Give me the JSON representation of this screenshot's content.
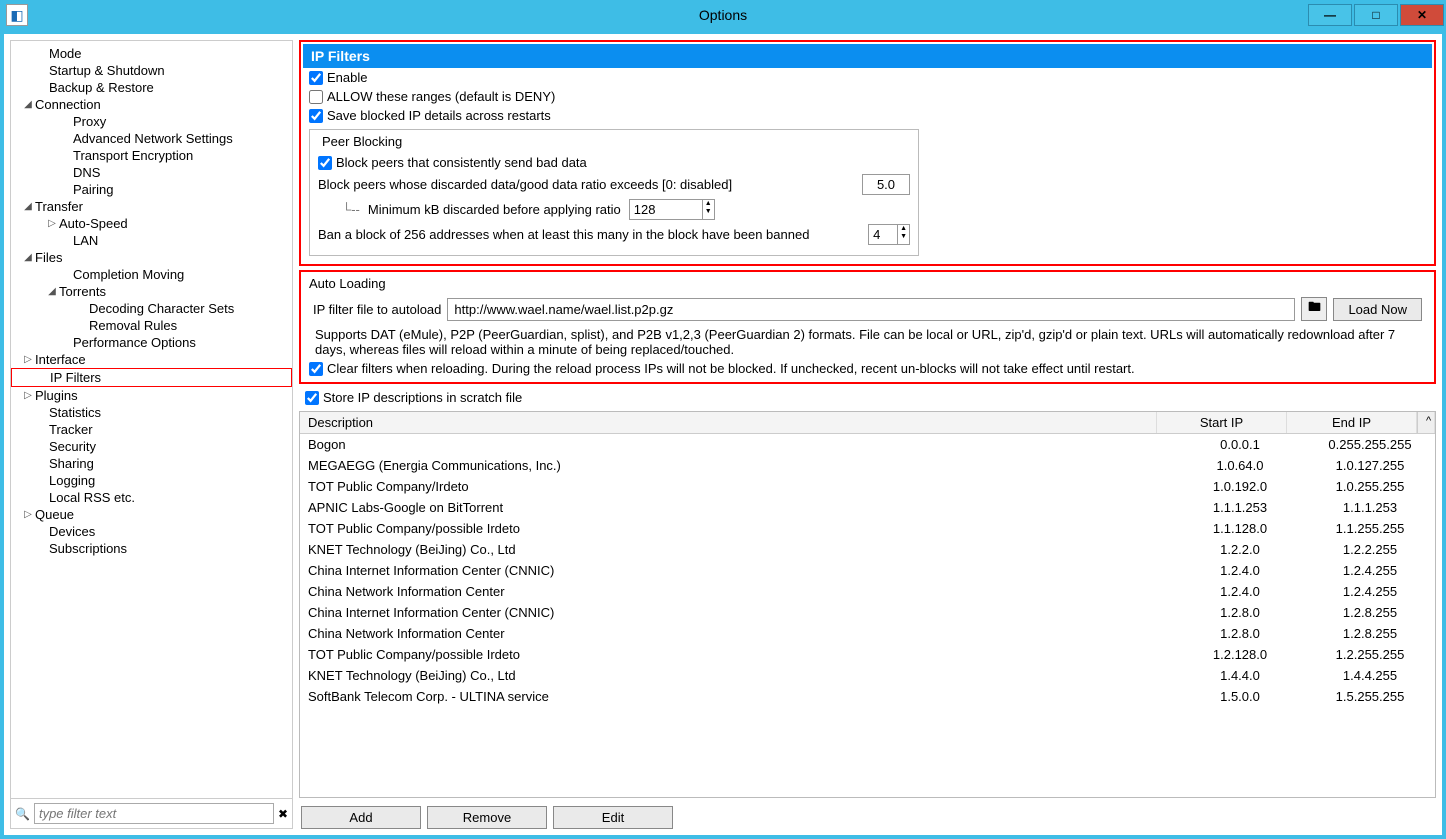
{
  "window": {
    "title": "Options"
  },
  "sidebar": {
    "filter_placeholder": "type filter text",
    "items": [
      {
        "label": "Mode",
        "indent": 24,
        "arrow": ""
      },
      {
        "label": "Startup & Shutdown",
        "indent": 24,
        "arrow": ""
      },
      {
        "label": "Backup & Restore",
        "indent": 24,
        "arrow": ""
      },
      {
        "label": "Connection",
        "indent": 10,
        "arrow": "◢"
      },
      {
        "label": "Proxy",
        "indent": 48,
        "arrow": ""
      },
      {
        "label": "Advanced Network Settings",
        "indent": 48,
        "arrow": ""
      },
      {
        "label": "Transport Encryption",
        "indent": 48,
        "arrow": ""
      },
      {
        "label": "DNS",
        "indent": 48,
        "arrow": ""
      },
      {
        "label": "Pairing",
        "indent": 48,
        "arrow": ""
      },
      {
        "label": "Transfer",
        "indent": 10,
        "arrow": "◢"
      },
      {
        "label": "Auto-Speed",
        "indent": 34,
        "arrow": "▷"
      },
      {
        "label": "LAN",
        "indent": 48,
        "arrow": ""
      },
      {
        "label": "Files",
        "indent": 10,
        "arrow": "◢"
      },
      {
        "label": "Completion Moving",
        "indent": 48,
        "arrow": ""
      },
      {
        "label": "Torrents",
        "indent": 34,
        "arrow": "◢"
      },
      {
        "label": "Decoding Character Sets",
        "indent": 64,
        "arrow": ""
      },
      {
        "label": "Removal Rules",
        "indent": 64,
        "arrow": ""
      },
      {
        "label": "Performance Options",
        "indent": 48,
        "arrow": ""
      },
      {
        "label": "Interface",
        "indent": 10,
        "arrow": "▷"
      },
      {
        "label": "IP Filters",
        "indent": 24,
        "arrow": "",
        "selected": true
      },
      {
        "label": "Plugins",
        "indent": 10,
        "arrow": "▷"
      },
      {
        "label": "Statistics",
        "indent": 24,
        "arrow": ""
      },
      {
        "label": "Tracker",
        "indent": 24,
        "arrow": ""
      },
      {
        "label": "Security",
        "indent": 24,
        "arrow": ""
      },
      {
        "label": "Sharing",
        "indent": 24,
        "arrow": ""
      },
      {
        "label": "Logging",
        "indent": 24,
        "arrow": ""
      },
      {
        "label": "Local RSS etc.",
        "indent": 24,
        "arrow": ""
      },
      {
        "label": "Queue",
        "indent": 10,
        "arrow": "▷"
      },
      {
        "label": "Devices",
        "indent": 24,
        "arrow": ""
      },
      {
        "label": "Subscriptions",
        "indent": 24,
        "arrow": ""
      }
    ]
  },
  "main": {
    "header": "IP Filters",
    "enable_label": "Enable",
    "allow_label": "ALLOW these ranges (default is DENY)",
    "save_blocked_label": "Save blocked IP details across restarts",
    "peer_blocking_title": "Peer Blocking",
    "block_peers_label": "Block peers that consistently send bad data",
    "ratio_label": "Block peers whose discarded data/good data ratio exceeds [0: disabled]",
    "ratio_value": "5.0",
    "min_kb_label": "Minimum kB discarded before applying ratio",
    "min_kb_value": "128",
    "ban_block_label": "Ban a block of 256 addresses when at least this many in the block have been banned",
    "ban_block_value": "4",
    "autoload_title": "Auto Loading",
    "autoload_label": "IP filter file to autoload",
    "autoload_value": "http://www.wael.name/wael.list.p2p.gz",
    "loadnow_label": "Load Now",
    "supports_text": "Supports DAT (eMule), P2P (PeerGuardian, splist), and P2B v1,2,3 (PeerGuardian 2) formats.  File can be local or URL, zip'd, gzip'd or plain text.  URLs will automatically redownload after 7 days, whereas files will reload within a minute of being replaced/touched.",
    "clear_filters_label": "Clear filters when reloading. During the reload process IPs will not be blocked. If unchecked, recent un-blocks will not take effect until restart.",
    "store_scratch_label": "Store IP descriptions in scratch file",
    "table": {
      "headers": {
        "desc": "Description",
        "start": "Start IP",
        "end": "End IP"
      },
      "rows": [
        {
          "desc": "Bogon",
          "start": "0.0.0.1",
          "end": "0.255.255.255"
        },
        {
          "desc": "MEGAEGG (Energia Communications, Inc.)",
          "start": "1.0.64.0",
          "end": "1.0.127.255"
        },
        {
          "desc": "TOT Public Company/Irdeto",
          "start": "1.0.192.0",
          "end": "1.0.255.255"
        },
        {
          "desc": "APNIC Labs-Google on BitTorrent",
          "start": "1.1.1.253",
          "end": "1.1.1.253"
        },
        {
          "desc": "TOT Public Company/possible Irdeto",
          "start": "1.1.128.0",
          "end": "1.1.255.255"
        },
        {
          "desc": "KNET Technology (BeiJing) Co., Ltd",
          "start": "1.2.2.0",
          "end": "1.2.2.255"
        },
        {
          "desc": "China Internet Information Center (CNNIC)",
          "start": "1.2.4.0",
          "end": "1.2.4.255"
        },
        {
          "desc": "China Network Information Center",
          "start": "1.2.4.0",
          "end": "1.2.4.255"
        },
        {
          "desc": "China Internet Information Center (CNNIC)",
          "start": "1.2.8.0",
          "end": "1.2.8.255"
        },
        {
          "desc": "China Network Information Center",
          "start": "1.2.8.0",
          "end": "1.2.8.255"
        },
        {
          "desc": "TOT Public Company/possible Irdeto",
          "start": "1.2.128.0",
          "end": "1.2.255.255"
        },
        {
          "desc": "KNET Technology (BeiJing) Co., Ltd",
          "start": "1.4.4.0",
          "end": "1.4.4.255"
        },
        {
          "desc": "SoftBank Telecom Corp. - ULTINA service",
          "start": "1.5.0.0",
          "end": "1.5.255.255"
        }
      ]
    },
    "buttons": {
      "add": "Add",
      "remove": "Remove",
      "edit": "Edit"
    }
  }
}
